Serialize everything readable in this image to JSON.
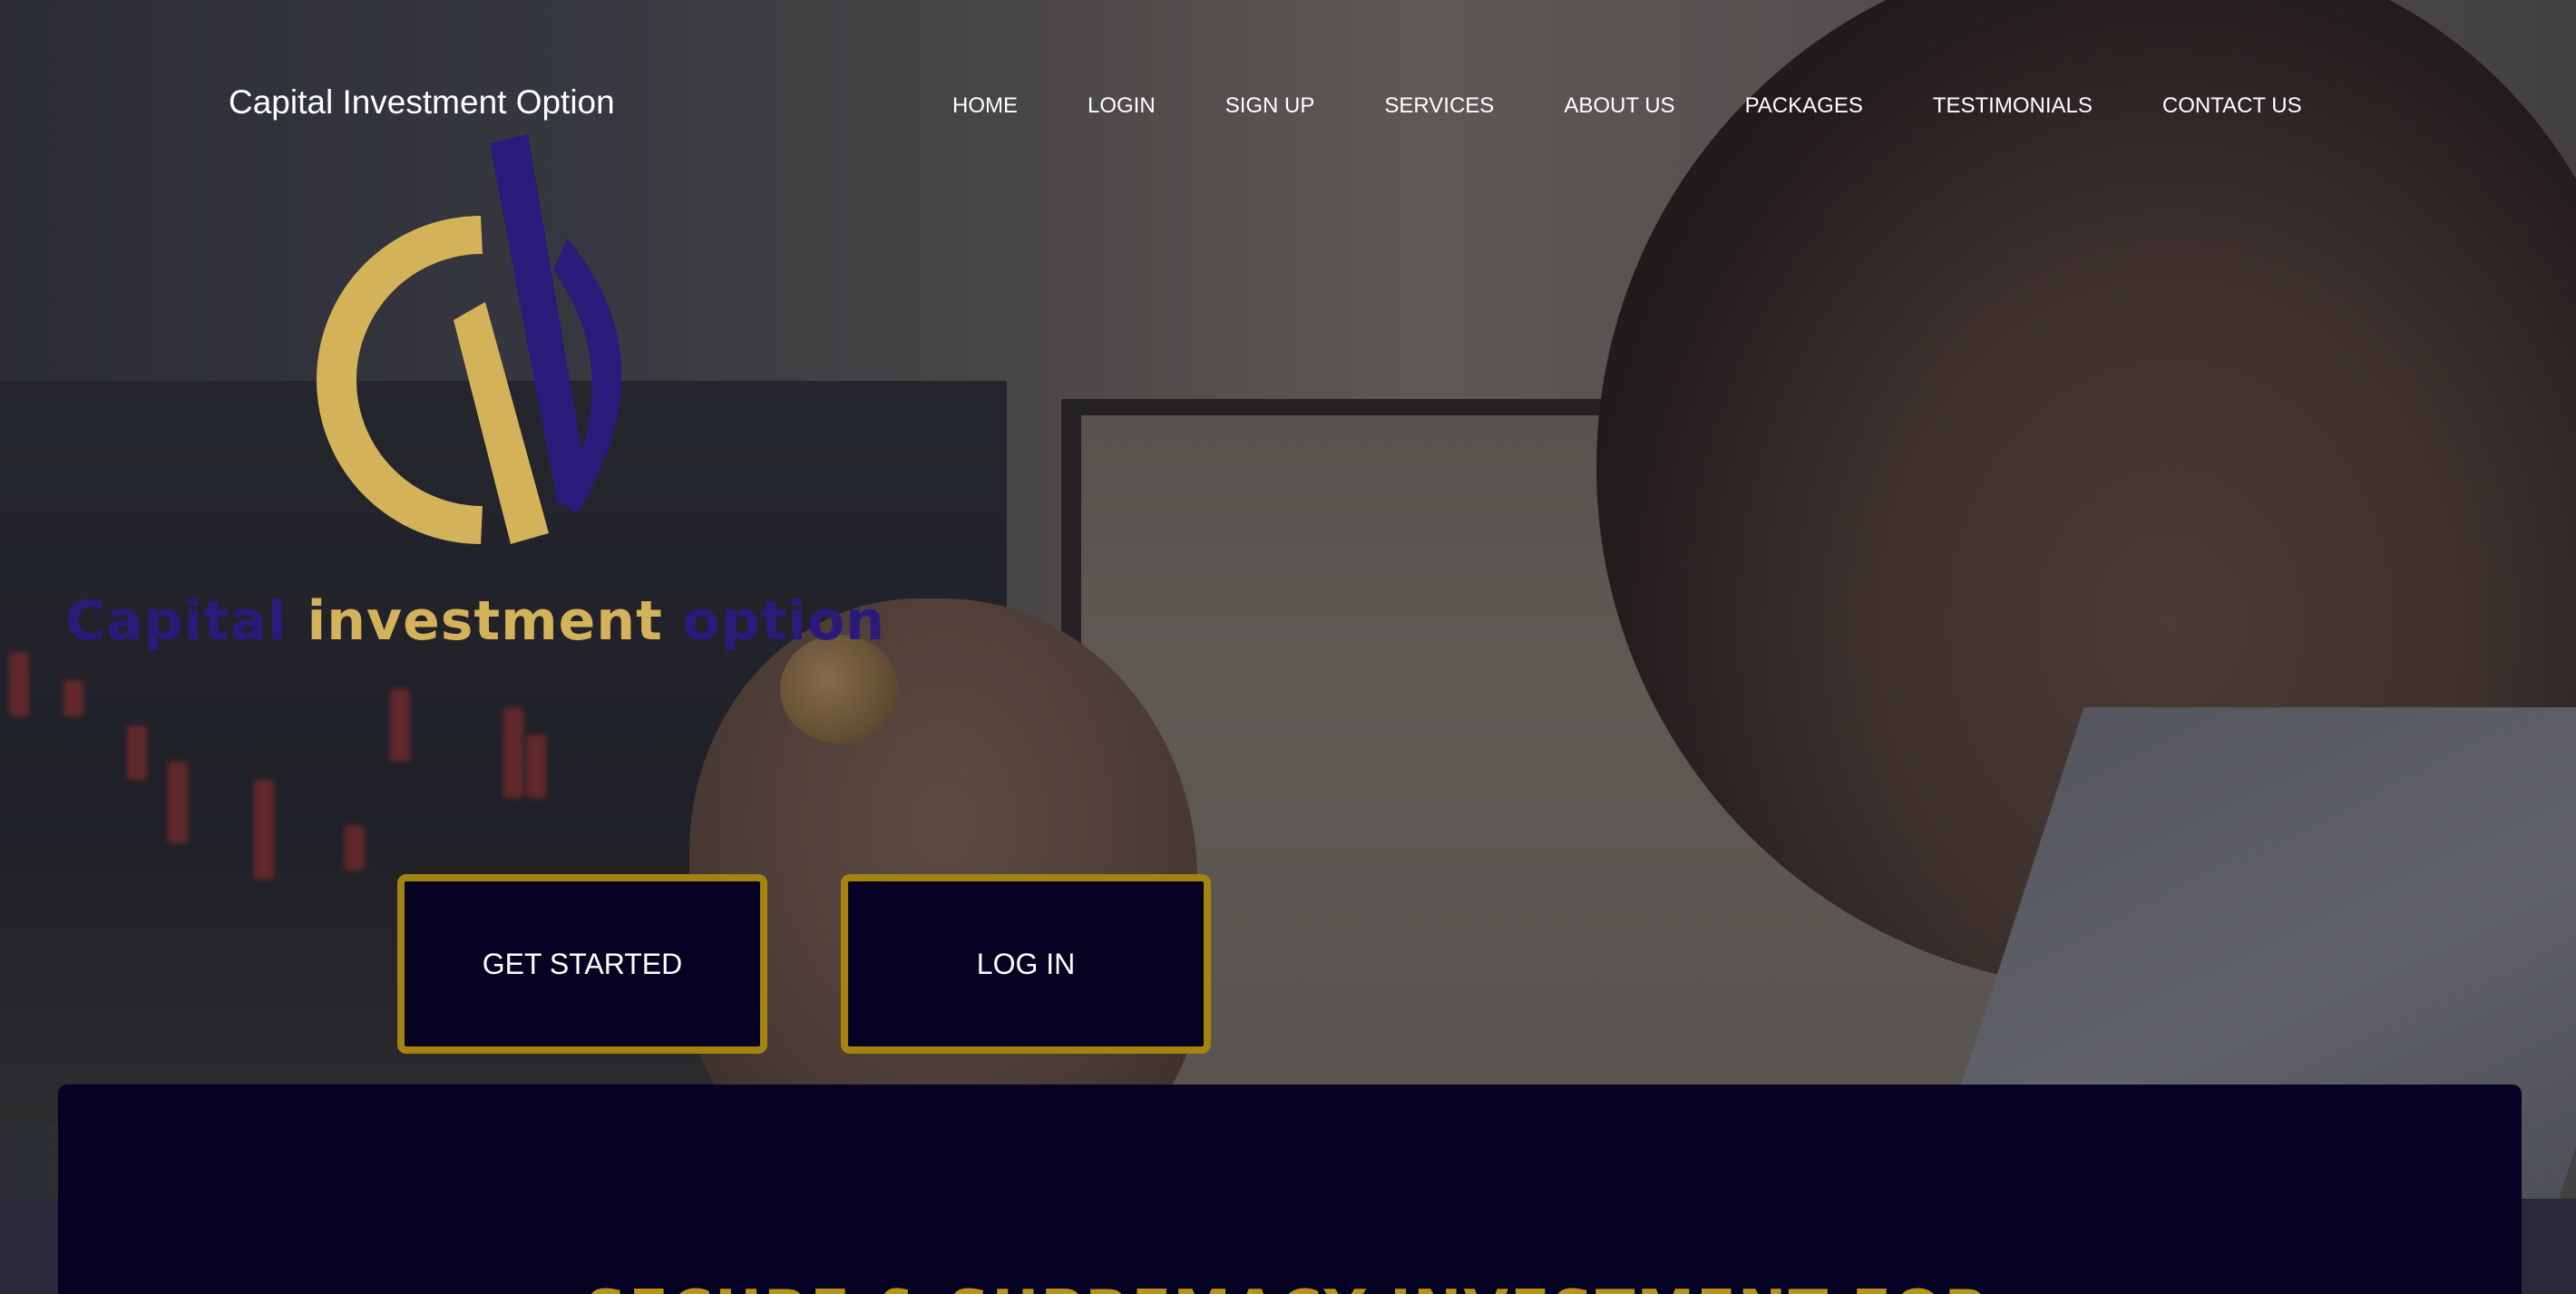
{
  "site": {
    "brand_title": "Capital Investment Option"
  },
  "nav": {
    "items": [
      {
        "label": "HOME"
      },
      {
        "label": "LOGIN"
      },
      {
        "label": "SIGN UP"
      },
      {
        "label": "SERVICES"
      },
      {
        "label": "ABOUT US"
      },
      {
        "label": "PACKAGES"
      },
      {
        "label": "TESTIMONIALS"
      },
      {
        "label": "CONTACT US"
      }
    ]
  },
  "logo": {
    "icon": "ci-logo-mark",
    "word1": "Capital",
    "word2": "investment",
    "word3": "option",
    "colors": {
      "navy": "#2a1a7a",
      "gold": "#d4b25a"
    }
  },
  "hero": {
    "get_started_label": "GET STARTED",
    "login_label": "LOG IN"
  },
  "section": {
    "heading_partial": "SECURE & SUPREMACY INVESTMENT FOR"
  },
  "colors": {
    "button_bg": "#050223",
    "button_border": "#a4840f",
    "panel_bg": "#050223",
    "heading_gold": "#b5951e"
  }
}
